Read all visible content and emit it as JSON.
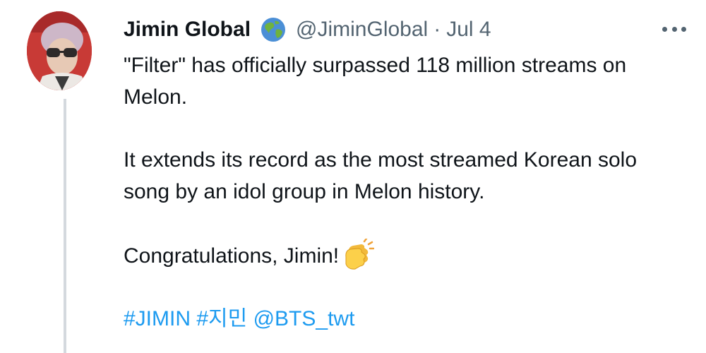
{
  "author": {
    "name": "Jimin Global",
    "badge_icon": "globe-icon",
    "handle": "@JiminGlobal",
    "separator": "·",
    "date": "Jul 4"
  },
  "more_icon": "more-options-icon",
  "tweet": {
    "line1": "\"Filter\" has officially surpassed 118 million streams on Melon.",
    "line2": "It extends its record as the most streamed Korean solo song by an idol group in Melon history.",
    "line3": "Congratulations, Jimin!",
    "line3_emoji": "clapping-hands-icon",
    "tags": [
      "#JIMIN",
      "#지민",
      "@BTS_twt"
    ]
  },
  "colors": {
    "link": "#1d9bf0",
    "secondary": "#536471",
    "thread_line": "#d4d9de"
  }
}
